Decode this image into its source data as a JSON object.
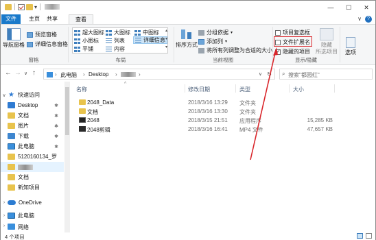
{
  "titlebar": {
    "dropdown_glyph": "▾",
    "title_text": "",
    "controls": {
      "minimize": "—",
      "maximize": "☐",
      "close": "✕"
    }
  },
  "ribbon_tabs": {
    "file": "文件",
    "home": "主页",
    "share": "共享",
    "view": "查看",
    "expand_glyph": "∨",
    "help_glyph": "?"
  },
  "ribbon": {
    "panes": {
      "nav_pane_label": "导航窗格",
      "preview_pane": "预览窗格",
      "details_pane": "详细信息窗格",
      "group_label": "窗格"
    },
    "layout": {
      "extra_large_icons": "超大图标",
      "large_icons": "大图标",
      "medium_icons": "中图标",
      "small_icons": "小图标",
      "list": "列表",
      "details": "详细信息",
      "tiles": "平铺",
      "content": "内容",
      "group_label": "布局"
    },
    "current_view": {
      "sort_by": "排序方式",
      "group_by": "分组依据",
      "add_column": "添加列",
      "size_all_columns": "将所有列调整为合适的大小",
      "group_label": "当前视图"
    },
    "show_hide": {
      "item_checkboxes": "项目复选框",
      "file_extensions": "文件扩展名",
      "hidden_items": "隐藏的项目",
      "hide_selected_line1": "隐藏",
      "hide_selected_line2": "所选项目",
      "group_label": "显示/隐藏"
    },
    "options": "选项"
  },
  "address_bar": {
    "back": "←",
    "forward": "→",
    "recent": "∨",
    "up": "↑",
    "crumbs": [
      "此电脑",
      "Desktop"
    ],
    "crumb_sep": "›",
    "refresh": "↻",
    "search_placeholder": "搜索\"都园红\""
  },
  "nav_pane": {
    "quick_access": "快速访问",
    "items": [
      {
        "label": "Desktop",
        "pinned": true
      },
      {
        "label": "文档",
        "pinned": true
      },
      {
        "label": "图片",
        "pinned": true
      },
      {
        "label": "下载",
        "pinned": true
      },
      {
        "label": "此电脑",
        "pinned": true
      },
      {
        "label": "5120160134_罗",
        "pinned": false
      },
      {
        "label": "",
        "pinned": false
      },
      {
        "label": "文档",
        "pinned": false
      },
      {
        "label": "新知项目",
        "pinned": false
      }
    ],
    "onedrive": "OneDrive",
    "this_pc": "此电脑",
    "network": "网络",
    "pin_glyph": "✱"
  },
  "file_list": {
    "columns": {
      "name": "名称",
      "modified": "修改日期",
      "type": "类型",
      "size": "大小"
    },
    "sort_glyph": "^",
    "rows": [
      {
        "name": "2048_Data",
        "modified": "2018/3/16 13:29",
        "type": "文件夹",
        "size": "",
        "icon": "folder-icon"
      },
      {
        "name": "文档",
        "modified": "2018/3/16 13:30",
        "type": "文件夹",
        "size": "",
        "icon": "folder-icon"
      },
      {
        "name": "2048",
        "modified": "2018/3/15 21:51",
        "type": "应用程序",
        "size": "15,285 KB",
        "icon": "app-icon"
      },
      {
        "name": "2048剪辑",
        "modified": "2018/3/16 16:41",
        "type": "MP4 文件",
        "size": "47,657 KB",
        "icon": "video-icon"
      }
    ]
  },
  "status_bar": {
    "text": "4 个项目"
  },
  "colors": {
    "accent": "#1979ca",
    "annotation": "#d9262b"
  }
}
